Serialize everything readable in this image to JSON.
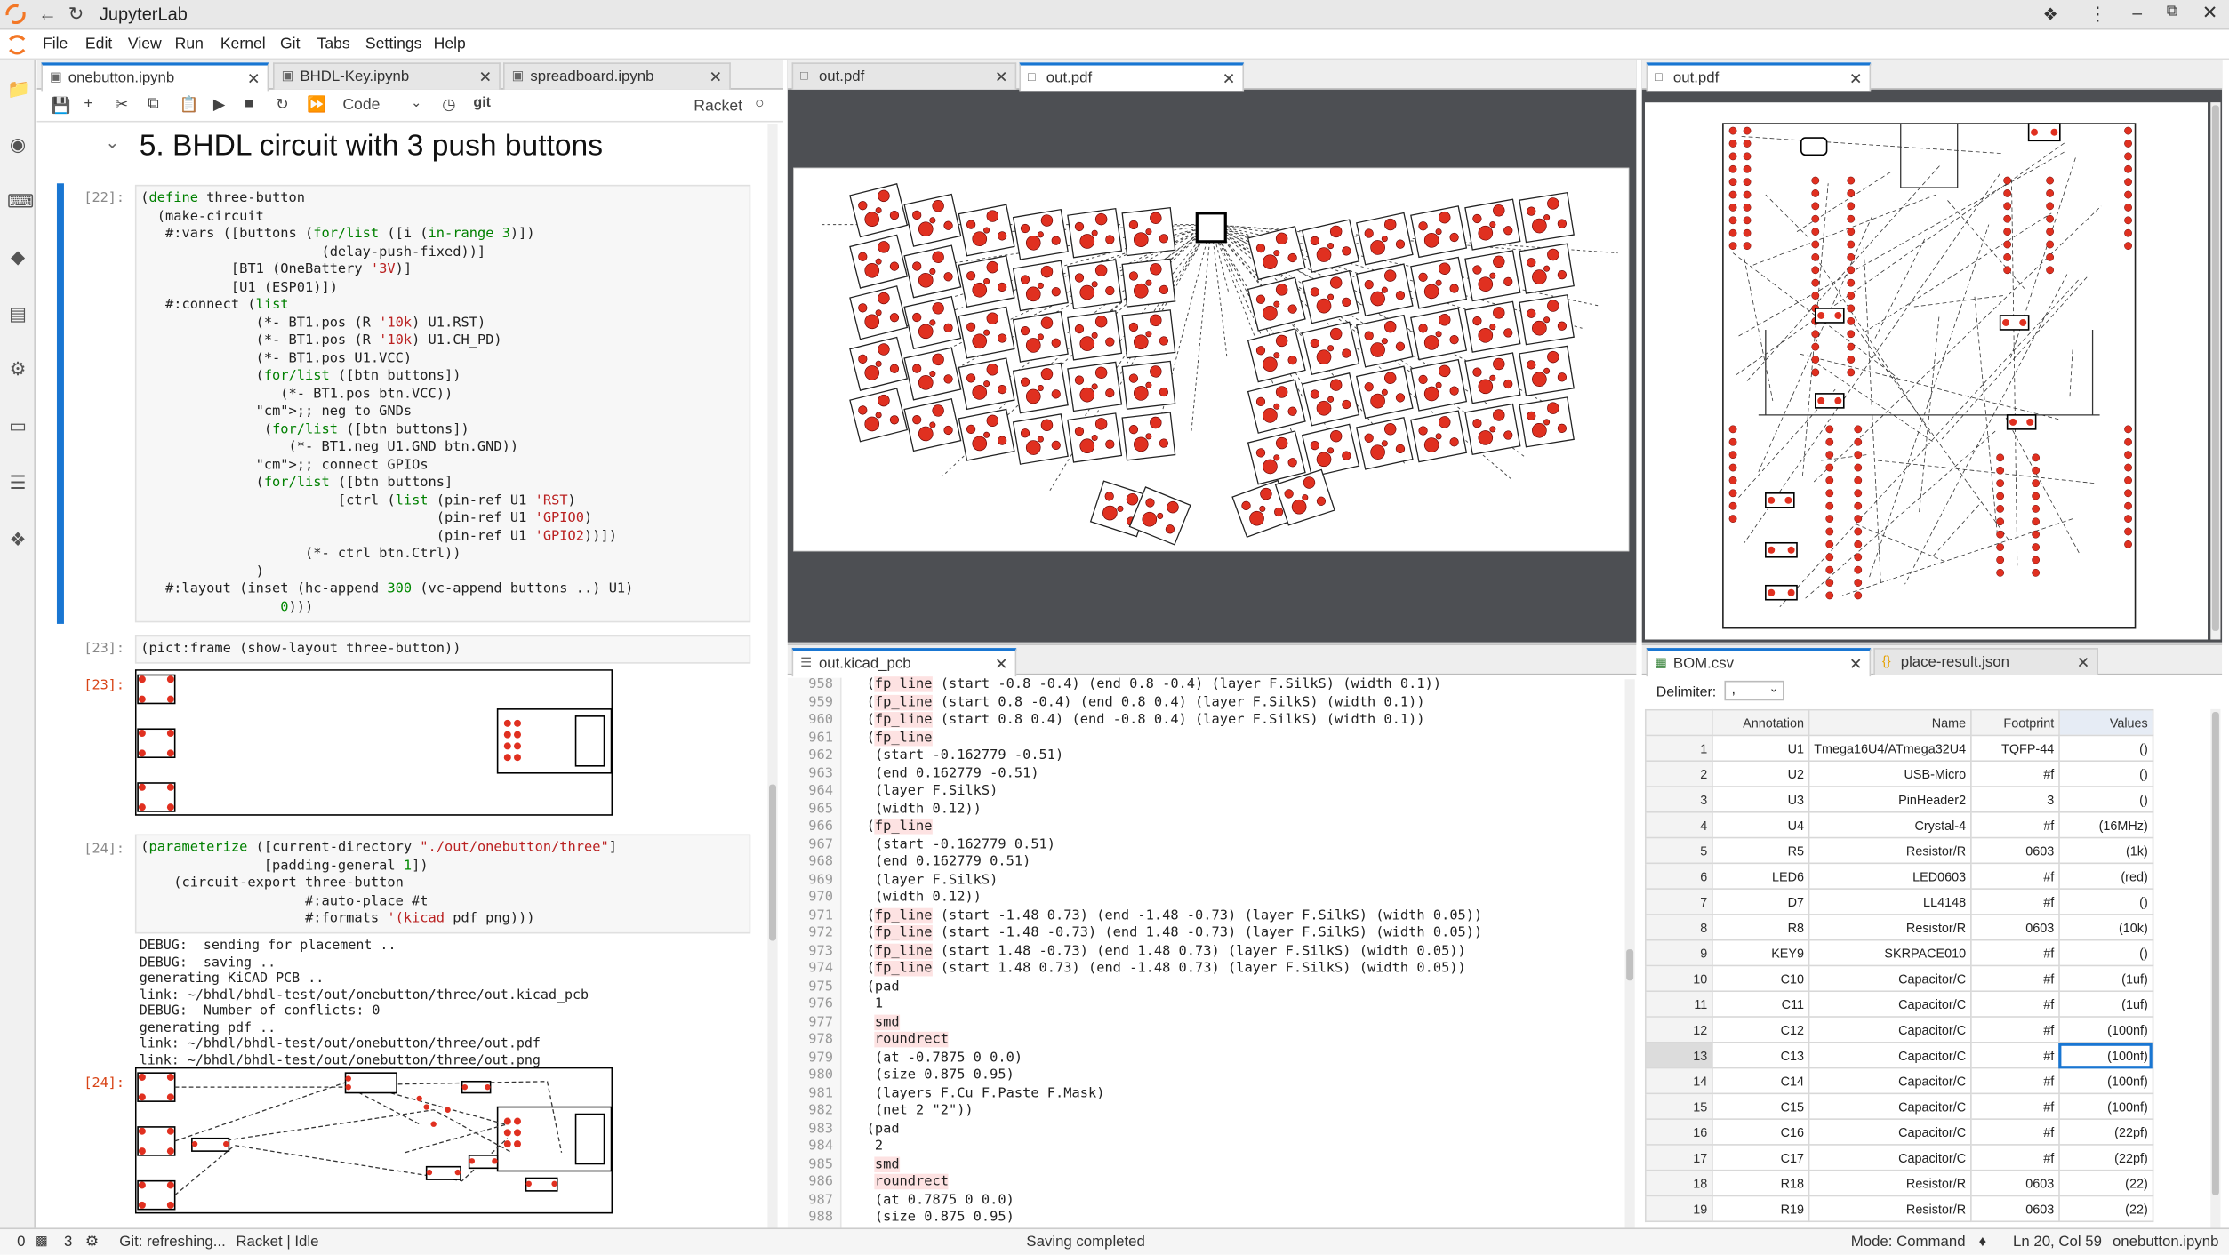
{
  "window": {
    "title": "JupyterLab"
  },
  "menu": [
    "File",
    "Edit",
    "View",
    "Run",
    "Kernel",
    "Git",
    "Tabs",
    "Settings",
    "Help"
  ],
  "notebook": {
    "tabs": [
      {
        "label": "onebutton.ipynb",
        "active": true
      },
      {
        "label": "BHDL-Key.ipynb",
        "active": false
      },
      {
        "label": "spreadboard.ipynb",
        "active": false
      }
    ],
    "toolbar": {
      "cell_type": "Code",
      "git_label": "git",
      "kernel": "Racket"
    },
    "heading": "5. BHDL circuit with 3 push buttons",
    "cells": [
      {
        "prompt": "[22]:"
      },
      {
        "prompt": "[23]:"
      },
      {
        "out_prompt": "[23]:"
      },
      {
        "prompt": "[24]:"
      },
      {
        "out_prompt": "[24]:"
      }
    ],
    "code22": [
      "(define three-button",
      "  (make-circuit",
      "   #:vars ([buttons (for/list ([i (in-range 3)])",
      "                      (delay-push-fixed))]",
      "           [BT1 (OneBattery '3V)]",
      "           [U1 (ESP01)])",
      "   #:connect (list",
      "              (*- BT1.pos (R '10k) U1.RST)",
      "              (*- BT1.pos (R '10k) U1.CH_PD)",
      "              (*- BT1.pos U1.VCC)",
      "              (for/list ([btn buttons])",
      "                 (*- BT1.pos btn.VCC))",
      "              ;; neg to GNDs",
      "               (for/list ([btn buttons])",
      "                  (*- BT1.neg U1.GND btn.GND))",
      "              ;; connect GPIOs",
      "              (for/list ([btn buttons]",
      "                        [ctrl (list (pin-ref U1 'RST)",
      "                                    (pin-ref U1 'GPIO0)",
      "                                    (pin-ref U1 'GPIO2))])",
      "                    (*- ctrl btn.Ctrl))",
      "              )",
      "   #:layout (inset (hc-append 300 (vc-append buttons ..) U1)",
      "                 0)))"
    ],
    "code23": "(pict:frame (show-layout three-button))",
    "code24": [
      "(parameterize ([current-directory \"./out/onebutton/three\"]",
      "               [padding-general 1])",
      "    (circuit-export three-button",
      "                    #:auto-place #t",
      "                    #:formats '(kicad pdf png)))"
    ],
    "output24": [
      "DEBUG:  sending for placement ..",
      "DEBUG:  saving ..",
      "generating KiCAD PCB ..",
      "link: ~/bhdl/bhdl-test/out/onebutton/three/out.kicad_pcb",
      "DEBUG:  Number of conflicts: 0",
      "generating pdf ..",
      "link: ~/bhdl/bhdl-test/out/onebutton/three/out.pdf",
      "link: ~/bhdl/bhdl-test/out/onebutton/three/out.png"
    ]
  },
  "pdf_left": {
    "tabs": [
      {
        "label": "out.pdf"
      },
      {
        "label": "out.pdf"
      }
    ]
  },
  "pdf_right": {
    "tabs": [
      {
        "label": "out.pdf"
      }
    ]
  },
  "kicad": {
    "tab": "out.kicad_pcb",
    "lines": [
      {
        "n": "958",
        "t": "  (fp_line (start -0.8 -0.4) (end 0.8 -0.4) (layer F.SilkS) (width 0.1))"
      },
      {
        "n": "959",
        "t": "  (fp_line (start 0.8 -0.4) (end 0.8 0.4) (layer F.SilkS) (width 0.1))"
      },
      {
        "n": "960",
        "t": "  (fp_line (start 0.8 0.4) (end -0.8 0.4) (layer F.SilkS) (width 0.1))"
      },
      {
        "n": "961",
        "t": "  (fp_line"
      },
      {
        "n": "962",
        "t": "   (start -0.162779 -0.51)"
      },
      {
        "n": "963",
        "t": "   (end 0.162779 -0.51)"
      },
      {
        "n": "964",
        "t": "   (layer F.SilkS)"
      },
      {
        "n": "965",
        "t": "   (width 0.12))"
      },
      {
        "n": "966",
        "t": "  (fp_line"
      },
      {
        "n": "967",
        "t": "   (start -0.162779 0.51)"
      },
      {
        "n": "968",
        "t": "   (end 0.162779 0.51)"
      },
      {
        "n": "969",
        "t": "   (layer F.SilkS)"
      },
      {
        "n": "970",
        "t": "   (width 0.12))"
      },
      {
        "n": "971",
        "t": "  (fp_line (start -1.48 0.73) (end -1.48 -0.73) (layer F.SilkS) (width 0.05))"
      },
      {
        "n": "972",
        "t": "  (fp_line (start -1.48 -0.73) (end 1.48 -0.73) (layer F.SilkS) (width 0.05))"
      },
      {
        "n": "973",
        "t": "  (fp_line (start 1.48 -0.73) (end 1.48 0.73) (layer F.SilkS) (width 0.05))"
      },
      {
        "n": "974",
        "t": "  (fp_line (start 1.48 0.73) (end -1.48 0.73) (layer F.SilkS) (width 0.05))"
      },
      {
        "n": "975",
        "t": "  (pad"
      },
      {
        "n": "976",
        "t": "   1"
      },
      {
        "n": "977",
        "t": "   smd"
      },
      {
        "n": "978",
        "t": "   roundrect"
      },
      {
        "n": "979",
        "t": "   (at -0.7875 0 0.0)"
      },
      {
        "n": "980",
        "t": "   (size 0.875 0.95)"
      },
      {
        "n": "981",
        "t": "   (layers F.Cu F.Paste F.Mask)"
      },
      {
        "n": "982",
        "t": "   (net 2 \"2\"))"
      },
      {
        "n": "983",
        "t": "  (pad"
      },
      {
        "n": "984",
        "t": "   2"
      },
      {
        "n": "985",
        "t": "   smd"
      },
      {
        "n": "986",
        "t": "   roundrect"
      },
      {
        "n": "987",
        "t": "   (at 0.7875 0 0.0)"
      },
      {
        "n": "988",
        "t": "   (size 0.875 0.95)"
      }
    ]
  },
  "bom": {
    "tabs": [
      {
        "label": "BOM.csv"
      },
      {
        "label": "place-result.json"
      }
    ],
    "delimiter_label": "Delimiter:",
    "delimiter_value": ",",
    "headers": [
      "Annotation",
      "Name",
      "Footprint",
      "Values"
    ],
    "rows": [
      [
        "1",
        "U1",
        "Tmega16U4/ATmega32U4",
        "TQFP-44",
        "()"
      ],
      [
        "2",
        "U2",
        "USB-Micro",
        "#f",
        "()"
      ],
      [
        "3",
        "U3",
        "PinHeader2",
        "3",
        "()"
      ],
      [
        "4",
        "U4",
        "Crystal-4",
        "#f",
        "(16MHz)"
      ],
      [
        "5",
        "R5",
        "Resistor/R",
        "0603",
        "(1k)"
      ],
      [
        "6",
        "LED6",
        "LED0603",
        "#f",
        "(red)"
      ],
      [
        "7",
        "D7",
        "LL4148",
        "#f",
        "()"
      ],
      [
        "8",
        "R8",
        "Resistor/R",
        "0603",
        "(10k)"
      ],
      [
        "9",
        "KEY9",
        "SKRPACE010",
        "#f",
        "()"
      ],
      [
        "10",
        "C10",
        "Capacitor/C",
        "#f",
        "(1uf)"
      ],
      [
        "11",
        "C11",
        "Capacitor/C",
        "#f",
        "(1uf)"
      ],
      [
        "12",
        "C12",
        "Capacitor/C",
        "#f",
        "(100nf)"
      ],
      [
        "13",
        "C13",
        "Capacitor/C",
        "#f",
        "(100nf)"
      ],
      [
        "14",
        "C14",
        "Capacitor/C",
        "#f",
        "(100nf)"
      ],
      [
        "15",
        "C15",
        "Capacitor/C",
        "#f",
        "(100nf)"
      ],
      [
        "16",
        "C16",
        "Capacitor/C",
        "#f",
        "(22pf)"
      ],
      [
        "17",
        "C17",
        "Capacitor/C",
        "#f",
        "(22pf)"
      ],
      [
        "18",
        "R18",
        "Resistor/R",
        "0603",
        "(22)"
      ],
      [
        "19",
        "R19",
        "Resistor/R",
        "0603",
        "(22)"
      ]
    ]
  },
  "status": {
    "left1": "0",
    "left2": "3",
    "git": "Git: refreshing...",
    "kernel": "Racket | Idle",
    "center": "Saving completed",
    "mode": "Mode: Command",
    "pos": "Ln 20, Col 59",
    "file": "onebutton.ipynb"
  },
  "colors": {
    "accent": "#1976d2",
    "pcb_pad": "#e03020",
    "pdf_bg": "#4d4f53"
  },
  "icons": [
    "jupyter-logo-icon",
    "back-arrow-icon",
    "reload-icon",
    "puzzle-icon",
    "more-icon",
    "folder-icon",
    "running-icon",
    "git-icon",
    "commands-icon",
    "property-icon",
    "tabs-icon",
    "toc-icon",
    "extension-icon"
  ]
}
